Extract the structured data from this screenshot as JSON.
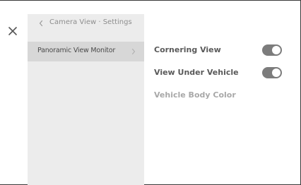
{
  "close": {
    "icon": "close-icon"
  },
  "breadcrumb": {
    "icon": "chevron-left-icon",
    "label": "Camera View · Settings"
  },
  "nav": {
    "items": [
      {
        "label": "Panoramic View Monitor",
        "icon": "chevron-right-icon",
        "selected": true
      }
    ]
  },
  "settings": [
    {
      "label": "Cornering View",
      "toggle": true,
      "on": true
    },
    {
      "label": "View Under Vehicle",
      "toggle": true,
      "on": true
    },
    {
      "label": "Vehicle Body Color",
      "toggle": false,
      "enabled": false
    }
  ],
  "colors": {
    "toggle_on": "#7c7c7c",
    "nav_selected": "#d7d7d7",
    "rail_background": "#ececec",
    "label_text": "#5a5a5a",
    "disabled_text": "#a8a8a8"
  }
}
